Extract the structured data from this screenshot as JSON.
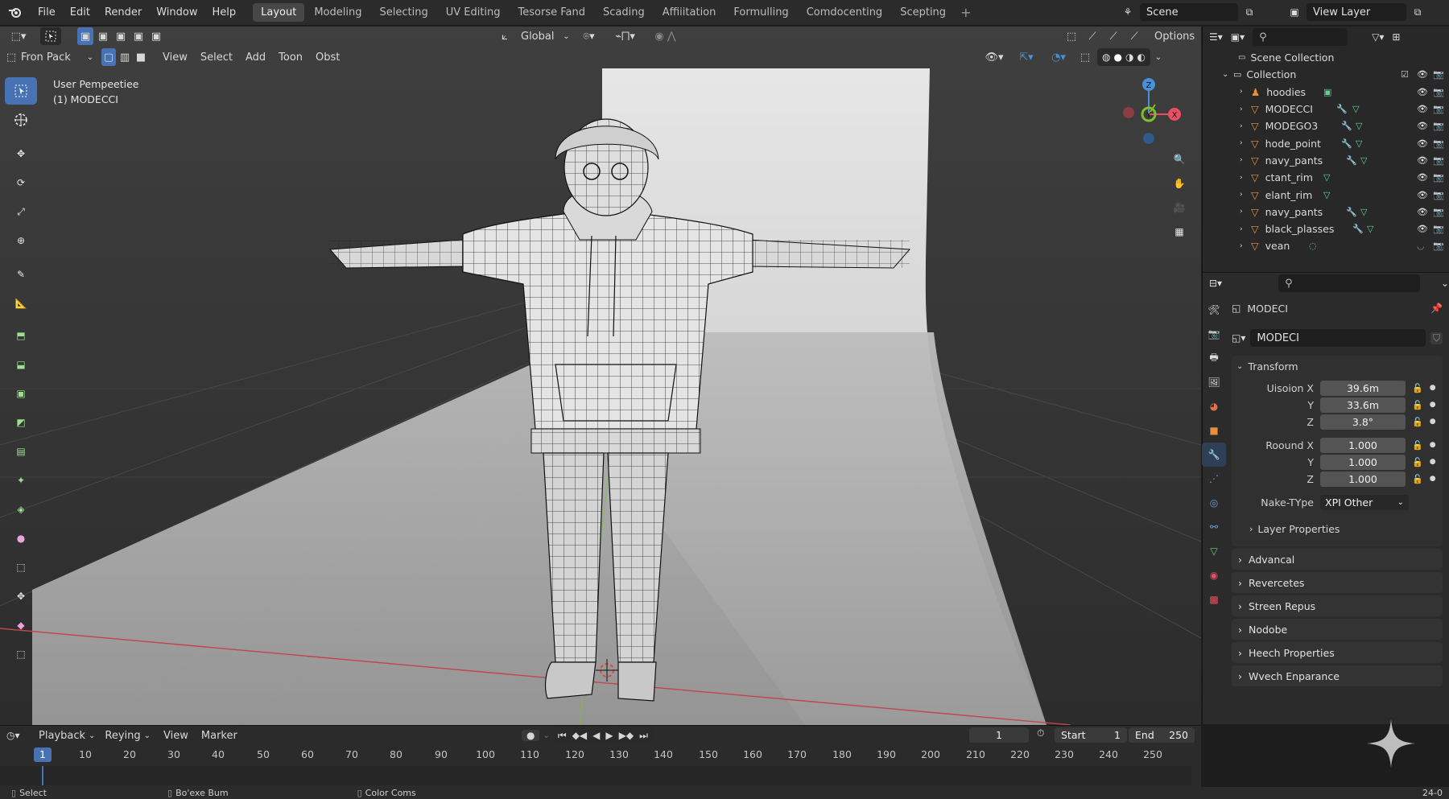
{
  "menubar": {
    "items": [
      "File",
      "Edit",
      "Render",
      "Window",
      "Help"
    ],
    "workspaces": [
      "Layout",
      "Modeling",
      "Selecting",
      "UV Editing",
      "Tesorse Fand",
      "Scading",
      "Affiiitation",
      "Formulling",
      "Comdocenting",
      "Scepting"
    ],
    "active_workspace": "Layout",
    "scene": "Scene",
    "view_layer": "View Layer"
  },
  "viewport": {
    "mode": "Fron Pack",
    "menus": [
      "View",
      "Select",
      "Add",
      "Toon",
      "Obst"
    ],
    "transform_orientation": "Global",
    "options_label": "Options",
    "overlay_title": "User Pempeetiee",
    "overlay_object": "(1) MODECCI",
    "gizmo_axes": {
      "x": "X",
      "y": "Y",
      "z": "Z"
    }
  },
  "outliner": {
    "scene_collection": "Scene Collection",
    "collection": "Collection",
    "items": [
      {
        "name": "hoodies"
      },
      {
        "name": "MODECCI"
      },
      {
        "name": "MODEGO3"
      },
      {
        "name": "hode_point"
      },
      {
        "name": "navy_pants"
      },
      {
        "name": "ctant_rim"
      },
      {
        "name": "elant_rim"
      },
      {
        "name": "navy_pants"
      },
      {
        "name": "black_plasses"
      },
      {
        "name": "vean"
      }
    ]
  },
  "properties": {
    "object_name": "MODECI",
    "datablock": "MODECI",
    "transform": {
      "title": "Transform",
      "location_label": "Uisoion X",
      "location": {
        "x": "39.6m",
        "y": "33.6m",
        "z": "3.8°"
      },
      "y_label": "Y",
      "z_label": "Z",
      "scale_label": "Roound X",
      "scale": {
        "x": "1.000",
        "y": "1.000",
        "z": "1.000"
      },
      "make_type_label": "Nake-TYpe",
      "make_type_value": "XPI Other",
      "layer_properties": "Layer Properties"
    },
    "panels": [
      "Advancal",
      "Revercetes",
      "Streen Repus",
      "Nodobe",
      "Heech Properties",
      "Wvech Enparance"
    ]
  },
  "timeline": {
    "menus": [
      "Playback",
      "Reying",
      "View",
      "Marker"
    ],
    "current_frame": "1",
    "start_label": "Start",
    "start": "1",
    "end_label": "End",
    "end": "250",
    "ticks": [
      "1",
      "10",
      "20",
      "30",
      "40",
      "50",
      "60",
      "70",
      "80",
      "90",
      "100",
      "110",
      "120",
      "130",
      "140",
      "150",
      "160",
      "170",
      "180",
      "190",
      "200",
      "210",
      "220",
      "230",
      "240",
      "250"
    ]
  },
  "statusbar": {
    "left": "Select",
    "middle": "Bo'exe Bum",
    "right": "Color Coms",
    "version": "24-0"
  },
  "colors": {
    "accent": "#4772b3",
    "object_orange": "#e88f3c",
    "mesh_green": "#5fd38a",
    "axis_x": "#e94e63",
    "axis_y": "#7fbf2e",
    "axis_z": "#4a90d9"
  }
}
